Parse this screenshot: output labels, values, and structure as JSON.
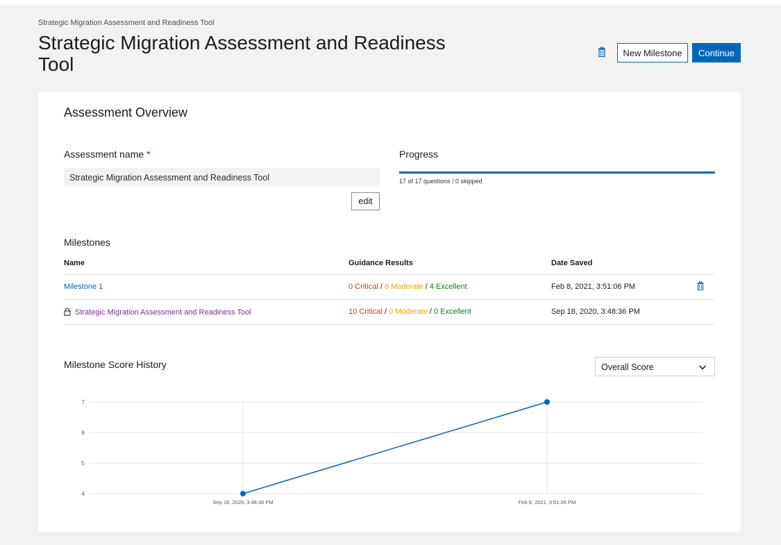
{
  "breadcrumb": "Strategic Migration Assessment and Readiness Tool",
  "page": {
    "title": "Strategic Migration Assessment and Readiness Tool",
    "new_milestone_label": "New Milestone",
    "continue_label": "Continue"
  },
  "overview": {
    "title": "Assessment Overview",
    "name_label": "Assessment name",
    "required_mark": "*",
    "name_value": "Strategic Migration Assessment and Readiness Tool",
    "edit_label": "edit",
    "progress_label": "Progress",
    "progress_text": "17 of 17 questions / 0 skipped",
    "progress_fraction": 1.0
  },
  "milestones": {
    "title": "Milestones",
    "columns": {
      "name": "Name",
      "guidance": "Guidance Results",
      "date": "Date Saved"
    },
    "rows": [
      {
        "name": "Milestone 1",
        "critical": "0 Critical",
        "moderate": "6 Moderate",
        "excellent": "4 Excellent",
        "date": "Feb 8, 2021, 3:51:06 PM",
        "locked": false,
        "visited": false
      },
      {
        "name": "Strategic Migration Assessment and Readiness Tool",
        "critical": "10 Critical",
        "moderate": "0 Moderate",
        "excellent": "0 Excellent",
        "date": "Sep 18, 2020, 3:48:36 PM",
        "locked": true,
        "visited": true
      }
    ],
    "separator": "/"
  },
  "history": {
    "title": "Milestone Score History",
    "select_value": "Overall Score"
  },
  "colors": {
    "accent": "#0067b8",
    "critical": "#d83b01",
    "moderate": "#f0a30a",
    "excellent": "#107c10",
    "visited_link": "#7a2d9c"
  },
  "icons": {
    "header_delete": "trash-icon",
    "row_delete": "trash-icon",
    "locked": "lock-icon",
    "dropdown": "chevron-down-icon"
  },
  "chart_data": {
    "type": "line",
    "x": [
      "Sep 18, 2020, 3:48:36 PM",
      "Feb 8, 2021, 3:51:06 PM"
    ],
    "series": [
      {
        "values": [
          4,
          7
        ]
      }
    ],
    "y_ticks": [
      4,
      5,
      6,
      7
    ],
    "ylim": [
      4,
      7
    ],
    "grid": true,
    "title": "",
    "xlabel": "",
    "ylabel": ""
  }
}
